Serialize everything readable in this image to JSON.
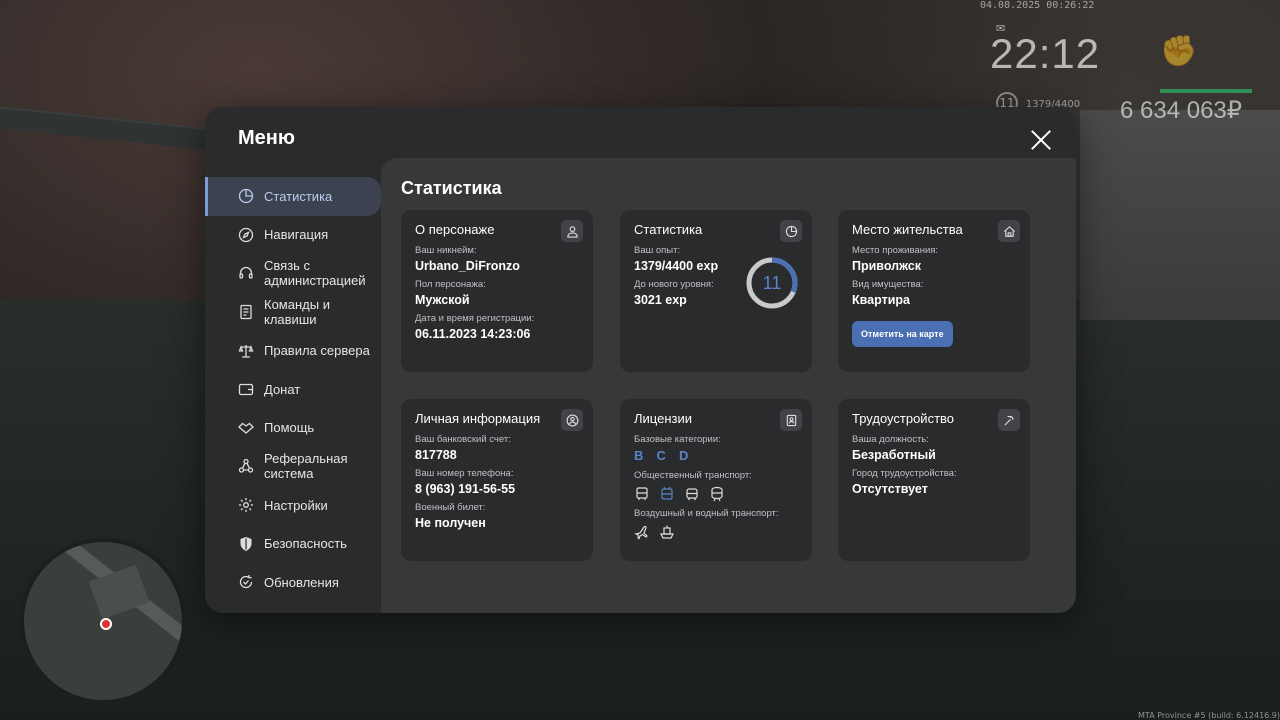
{
  "hud": {
    "datetime": "04.08.2025 00:26:22",
    "time": "22:12",
    "level": "11",
    "exp": "1379/4400",
    "money": "6 634 063₽",
    "build": "MTA Province #5 (build: 6.12416.9)"
  },
  "menu": {
    "title": "Меню",
    "content_title": "Статистика"
  },
  "sidebar": {
    "items": [
      {
        "label": "Статистика",
        "icon": "pie-chart-icon"
      },
      {
        "label": "Навигация",
        "icon": "compass-icon"
      },
      {
        "label": "Связь с администрацией",
        "icon": "headset-icon"
      },
      {
        "label": "Команды и клавиши",
        "icon": "document-icon"
      },
      {
        "label": "Правила сервера",
        "icon": "scales-icon"
      },
      {
        "label": "Донат",
        "icon": "wallet-icon"
      },
      {
        "label": "Помощь",
        "icon": "handshake-icon"
      },
      {
        "label": "Реферальная система",
        "icon": "network-icon"
      },
      {
        "label": "Настройки",
        "icon": "gear-icon"
      },
      {
        "label": "Безопасность",
        "icon": "shield-icon"
      },
      {
        "label": "Обновления",
        "icon": "refresh-icon"
      }
    ]
  },
  "cards": {
    "character": {
      "title": "О персонаже",
      "nick_label": "Ваш никнейм:",
      "nick": "Urbano_DiFronzo",
      "sex_label": "Пол персонажа:",
      "sex": "Мужской",
      "reg_label": "Дата и время регистрации:",
      "reg": "06.11.2023 14:23:06"
    },
    "stats": {
      "title": "Статистика",
      "exp_label": "Ваш опыт:",
      "exp": "1379/4400 exp",
      "next_label": "До нового уровня:",
      "next": "3021 exp",
      "level": "11",
      "progress": 0.313
    },
    "residence": {
      "title": "Место жительства",
      "place_label": "Место проживания:",
      "place": "Приволжск",
      "type_label": "Вид имущества:",
      "type": "Квартира",
      "button": "Отметить на карте"
    },
    "personal": {
      "title": "Личная информация",
      "bank_label": "Ваш банковский счет:",
      "bank": "817788",
      "phone_label": "Ваш номер телефона:",
      "phone": "8 (963) 191-56-55",
      "military_label": "Военный билет:",
      "military": "Не получен"
    },
    "licenses": {
      "title": "Лицензии",
      "base_label": "Базовые категории:",
      "categories": [
        "B",
        "C",
        "D"
      ],
      "public_label": "Общественный транспорт:",
      "air_label": "Воздушный и водный транспорт:"
    },
    "job": {
      "title": "Трудоустройство",
      "position_label": "Ваша должность:",
      "position": "Безработный",
      "city_label": "Город трудоустройства:",
      "city": "Отсутствует"
    }
  },
  "colors": {
    "accent": "#4a6fb3",
    "active_text": "#b9cbf0",
    "category": "#5a84c9"
  }
}
